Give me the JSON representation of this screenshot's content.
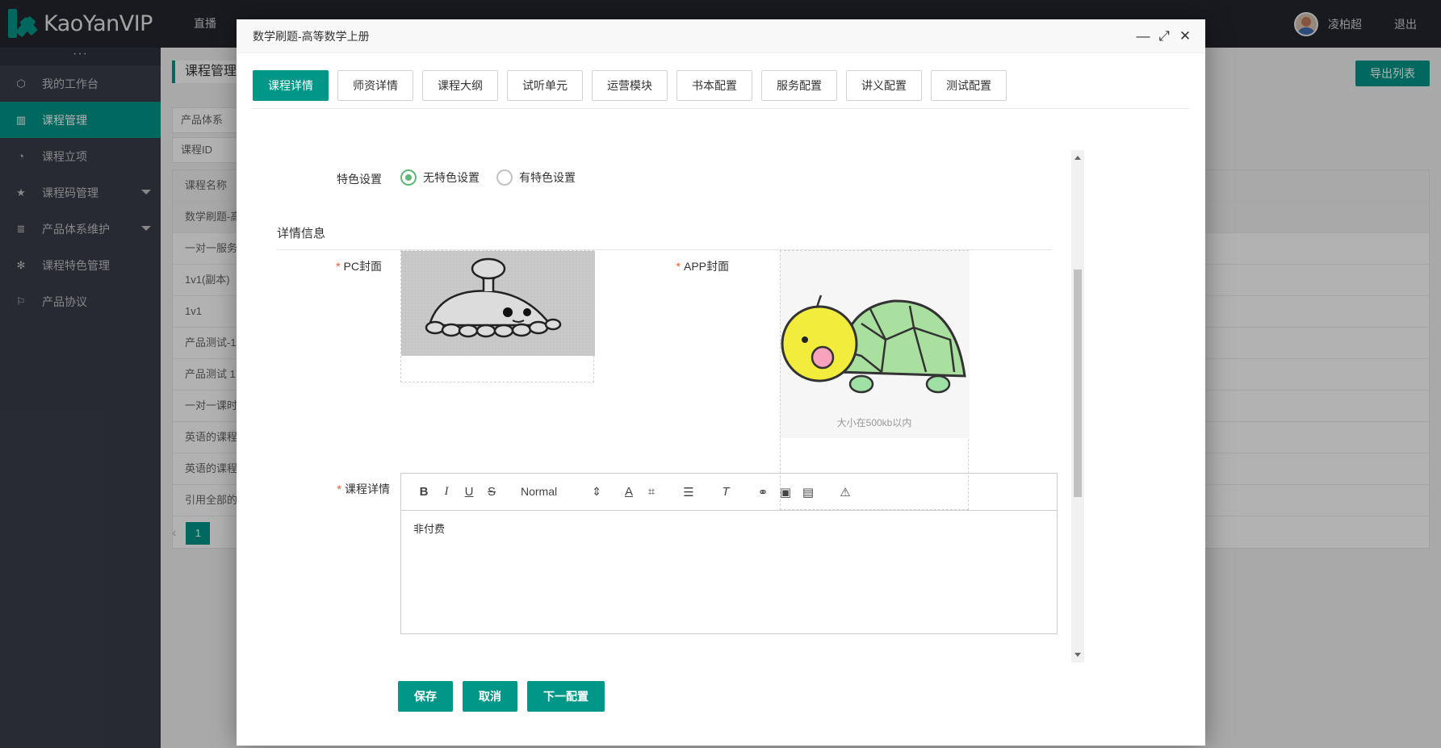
{
  "app": {
    "logo_text": "KaoYanVIP",
    "top_nav": [
      "直播",
      "…",
      "…",
      "…",
      "…",
      "…"
    ],
    "user_name": "凌柏超",
    "logout": "退出"
  },
  "sidebar": {
    "fold": "···",
    "items": [
      {
        "label": "我的工作台",
        "icon": "cube-icon"
      },
      {
        "label": "课程管理",
        "icon": "book-icon",
        "active": true
      },
      {
        "label": "课程立项",
        "icon": "clock-icon"
      },
      {
        "label": "课程码管理",
        "icon": "star-icon",
        "has_caret": true
      },
      {
        "label": "产品体系维护",
        "icon": "doc-icon",
        "has_caret": true
      },
      {
        "label": "课程特色管理",
        "icon": "gear-icon"
      },
      {
        "label": "产品协议",
        "icon": "flag-icon"
      }
    ]
  },
  "main": {
    "breadcrumb": "课程管理",
    "export_button": "导出列表",
    "filters": [
      "产品体系",
      "课程ID"
    ],
    "table_header": "课程名称",
    "rows": [
      "数学刷题-高",
      "一对一服务",
      "1v1(副本)",
      "1v1",
      "产品测试-1",
      "产品测试 1",
      "一对一课时",
      "英语的课程",
      "英语的课程",
      "引用全部的"
    ],
    "pager": {
      "prev": "‹",
      "current": "1"
    }
  },
  "modal": {
    "title": "数学刷题-高等数学上册",
    "controls": {
      "minimize": "—",
      "maximize": "⤢",
      "close": "✕"
    },
    "tabs": [
      "课程详情",
      "师资详情",
      "课程大纲",
      "试听单元",
      "运营模块",
      "书本配置",
      "服务配置",
      "讲义配置",
      "测试配置"
    ],
    "active_tab": "课程详情",
    "feature_label": "特色设置",
    "feature_options": [
      "无特色设置",
      "有特色设置"
    ],
    "feature_selected": "无特色设置",
    "section_title": "详情信息",
    "pc_cover_label": "PC封面",
    "app_cover_label": "APP封面",
    "app_cover_hint": "大小在500kb以内",
    "detail_label": "课程详情",
    "editor": {
      "toolbar": [
        "B",
        "I",
        "U",
        "S"
      ],
      "format_select": "Normal",
      "body_text": "非付费"
    },
    "buttons": {
      "save": "保存",
      "cancel": "取消",
      "next": "下一配置"
    }
  },
  "colors": {
    "accent": "#009688",
    "topbar": "#23262e",
    "sidebar": "#393d49",
    "required": "#ff5722",
    "radio_on": "#5fb878"
  }
}
